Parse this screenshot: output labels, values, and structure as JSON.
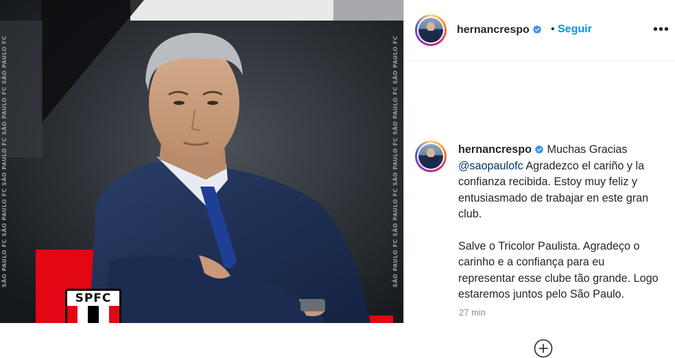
{
  "post": {
    "image_side_text": "SÃO PAULO FC SÃO PAULO FC SÃO PAULO FC SÃO PAULO FC SÃO PAULO FC",
    "badge_text": "SPFC",
    "badge_colors": {
      "red": "#e30613",
      "black": "#000000",
      "white": "#ffffff"
    }
  },
  "header": {
    "username": "hernancrespo",
    "verified": true,
    "separator": "•",
    "follow_label": "Seguir",
    "more_icon": "more-options-icon",
    "more_label": "•••"
  },
  "caption": {
    "username": "hernancrespo",
    "paragraph1_prefix": " Muchas Gracias ",
    "mention": "@saopaulofc",
    "paragraph1_suffix": " Agradezco el cariño y la confianza recibida. Estoy muy feliz y entusiasmado de trabajar en este gran club.",
    "paragraph2": "Salve o Tricolor Paulista. Agradeço o carinho e a confiança para eu representar esse clube tão grande. Logo estaremos juntos pelo São Paulo.",
    "timestamp": "27 min"
  },
  "actions": {
    "add_comment_icon": "plus-circle-icon"
  },
  "colors": {
    "accent": "#0095f6",
    "link": "#00376b",
    "muted": "#8e8e8e",
    "verified": "#3897f0"
  }
}
